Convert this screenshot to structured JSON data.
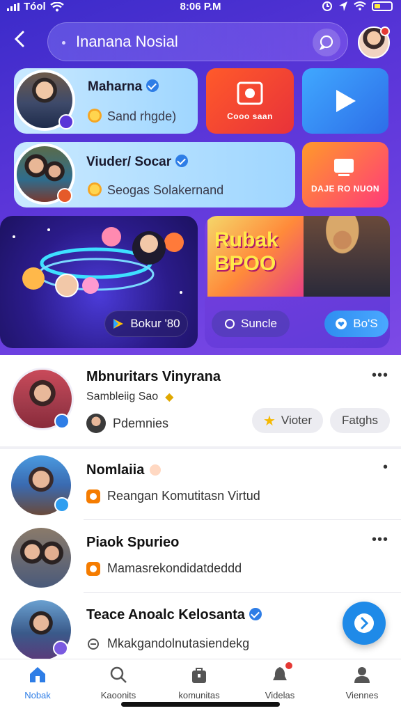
{
  "status_bar": {
    "carrier": "Tóol",
    "time": "8:06 P.M"
  },
  "header": {
    "title": "Inanana Nosial"
  },
  "cards": [
    {
      "name": "Maharna",
      "subtitle": "Sand rhgde)"
    },
    {
      "name": "Viuder/ Socar",
      "subtitle": "Seogas Solakernand"
    }
  ],
  "tiles": [
    {
      "label": "Cooo saan",
      "color": "#f04a2a",
      "icon": "film-icon"
    },
    {
      "label": "",
      "color": "#3c8ef0",
      "icon": "play-icon"
    },
    {
      "label": "DAJE RO NUON",
      "color": "#ff6a2a",
      "icon": "display-icon"
    }
  ],
  "banners": {
    "left_button": "Bokur '80",
    "right_title": "Rubak BPOO",
    "right_button_1": "Suncle",
    "right_button_2": "Bo'S"
  },
  "featured": {
    "name": "Mbnuritars Vinyrana",
    "subtitle": "Sambleiig Sao",
    "owner": "Pdemnies",
    "chip_1": "Vioter",
    "chip_2": "Fatghs"
  },
  "list": [
    {
      "name": "Nomlaiia",
      "subtitle": "Reangan Komutitasn Virtud"
    },
    {
      "name": "Piaok Spurieo",
      "subtitle": "Mamasrekondidatdeddd"
    },
    {
      "name": "Teace Anoalc Kelosanta",
      "subtitle": "Mkakgandolnutasiendekg"
    }
  ],
  "bottom_nav": [
    {
      "label": "Nobak",
      "icon": "home-icon",
      "active": true
    },
    {
      "label": "Kaoonits",
      "icon": "search-icon",
      "active": false
    },
    {
      "label": "komunitas",
      "icon": "bag-icon",
      "active": false
    },
    {
      "label": "Videlas",
      "icon": "bell-icon",
      "active": false
    },
    {
      "label": "Viennes",
      "icon": "person-icon",
      "active": false
    }
  ],
  "colors": {
    "accent": "#2e7de6",
    "gradient_top": "#3b2bc9",
    "gradient_bottom": "#7d4ae6"
  }
}
